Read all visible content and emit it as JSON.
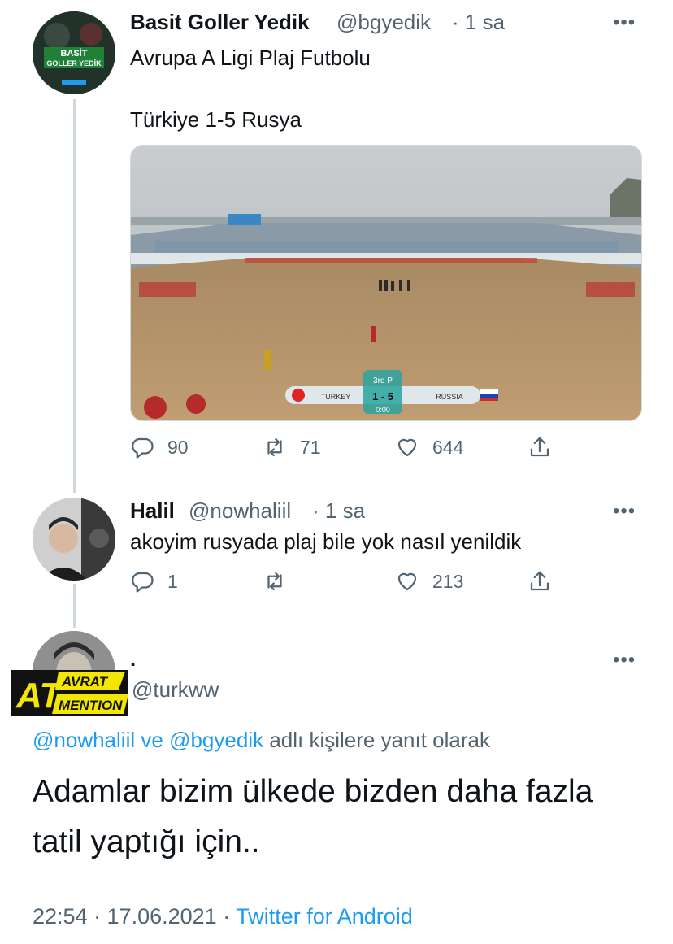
{
  "tweet1": {
    "author_name": "Basit Goller Yedik",
    "author_handle": "@bgyedik",
    "time": "· 1 sa",
    "line1": "Avrupa A Ligi Plaj Futbolu",
    "line2": "Türkiye 1-5 Rusya",
    "avatar_text_1": "BASİT",
    "avatar_text_2": "GOLLER YEDİK",
    "scoreboard": {
      "period": "3rd P",
      "team_left": "TURKEY",
      "score": "1 - 5",
      "team_right": "RUSSIA",
      "clock": "0:00"
    },
    "replies": "90",
    "retweets": "71",
    "likes": "644"
  },
  "tweet2": {
    "author_name": "Halil",
    "author_handle": "@nowhaliil",
    "time": "· 1 sa",
    "text": "akoyim rusyada plaj bile yok nasıl yenildik",
    "replies": "1",
    "retweets": "",
    "likes": "213"
  },
  "main_tweet": {
    "author_name": ".",
    "author_handle": "@turkww",
    "badge_top": "AVRAT",
    "badge_at": "AT",
    "badge_bottom": "MENTION",
    "reply_to_1": "@nowhaliil",
    "reply_conj": "ve",
    "reply_to_2": "@bgyedik",
    "reply_suffix": "adlı kişilere yanıt olarak",
    "text_line1": "Adamlar bizim ülkede bizden daha fazla",
    "text_line2": "tatil yaptığı için..",
    "timestamp": "22:54 · 17.06.2021 ·",
    "source": "Twitter for Android"
  },
  "icons": [
    "reply-icon",
    "retweet-icon",
    "like-icon",
    "share-icon",
    "more-icon"
  ],
  "colors": {
    "link": "#1d9bf0",
    "muted": "#536471",
    "line": "#cfd9de",
    "sand": "#b89468",
    "brand_green": "#1f8a3a"
  }
}
